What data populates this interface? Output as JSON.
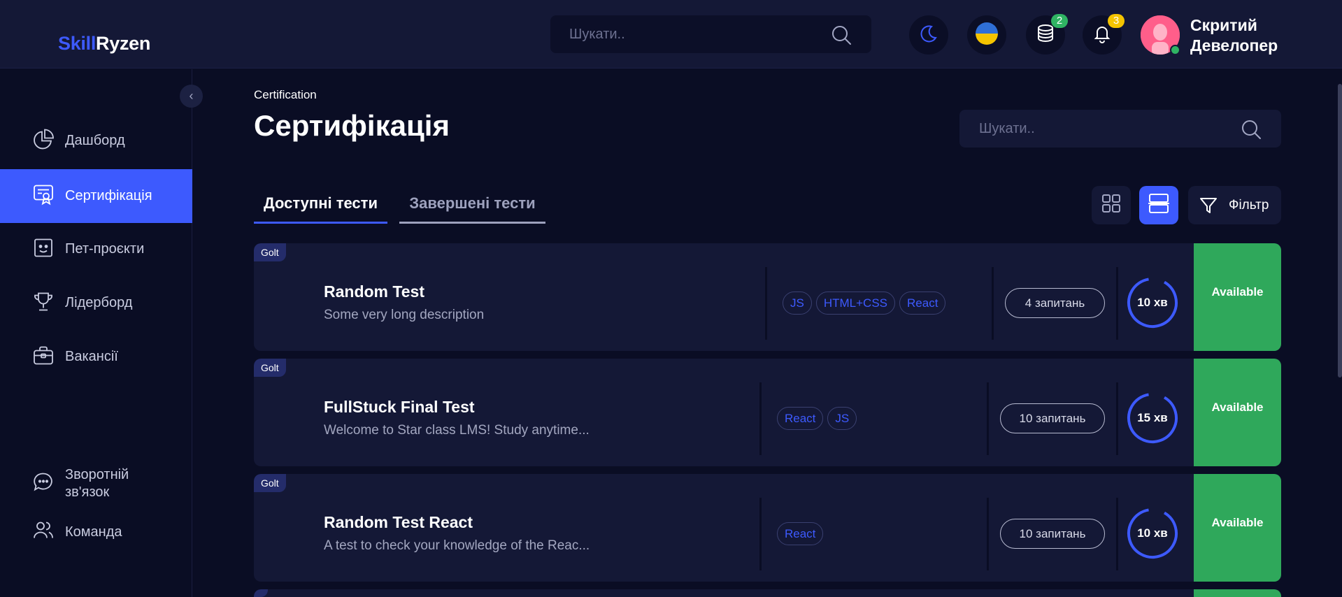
{
  "header": {
    "logo_part1": "Skill",
    "logo_part2": "Ryzen",
    "search_placeholder": "Шукати..",
    "coins_badge": "2",
    "notifications_badge": "3",
    "user_name_line1": "Скритий",
    "user_name_line2": "Девелопер"
  },
  "sidebar": {
    "items": [
      {
        "label": "Дашборд"
      },
      {
        "label": "Сертифікація"
      },
      {
        "label": "Пет-проєкти"
      },
      {
        "label": "Лідерборд"
      },
      {
        "label": "Вакансії"
      }
    ],
    "feedback_line1": "Зворотній",
    "feedback_line2": "зв'язок",
    "team": "Команда",
    "collapse_glyph": "‹"
  },
  "main": {
    "breadcrumb": "Certification",
    "title": "Сертифікація",
    "search_placeholder": "Шукати..",
    "tabs": [
      {
        "label": "Доступні тести"
      },
      {
        "label": "Завершені тести"
      }
    ],
    "filter_label": "Фільтр"
  },
  "tests": [
    {
      "org": "Golt",
      "title": "Random Test",
      "description": "Some very long description",
      "tags": [
        "JS",
        "HTML+CSS",
        "React"
      ],
      "questions": "4 запитань",
      "duration": "10 хв",
      "status": "Available"
    },
    {
      "org": "Golt",
      "title": "FullStuck Final Test",
      "description": "Welcome to Star class LMS! Study anytime...",
      "tags": [
        "React",
        "JS"
      ],
      "questions": "10 запитань",
      "duration": "15 хв",
      "status": "Available"
    },
    {
      "org": "Golt",
      "title": "Random Test React",
      "description": "A test to check your knowledge of the Reac...",
      "tags": [
        "React"
      ],
      "questions": "10 запитань",
      "duration": "10 хв",
      "status": "Available"
    }
  ],
  "colors": {
    "accent": "#3d5afe",
    "available": "#2fa85b",
    "background": "#0a0d24",
    "panel": "#141836"
  }
}
